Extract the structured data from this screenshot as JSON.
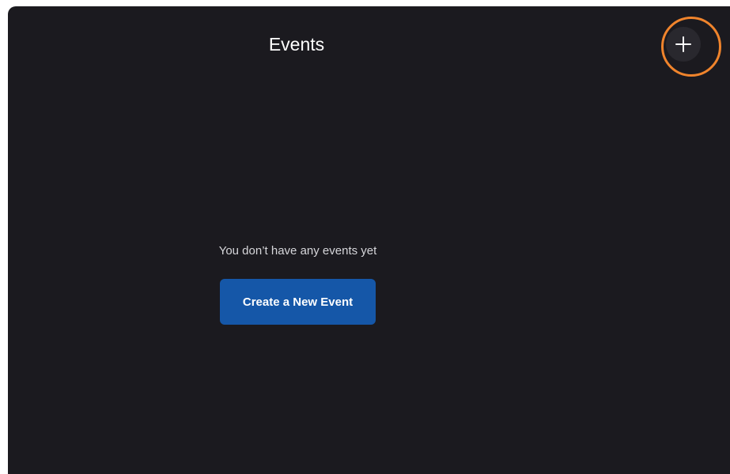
{
  "header": {
    "title": "Events"
  },
  "add_button": {
    "label": "+",
    "icon": "plus-icon",
    "highlight_color": "#f0842c"
  },
  "empty_state": {
    "message": "You don’t have any events yet",
    "button_label": "Create a New Event"
  },
  "colors": {
    "background": "#1b1a1f",
    "primary_button": "#1557a8",
    "text": "#ffffff"
  }
}
